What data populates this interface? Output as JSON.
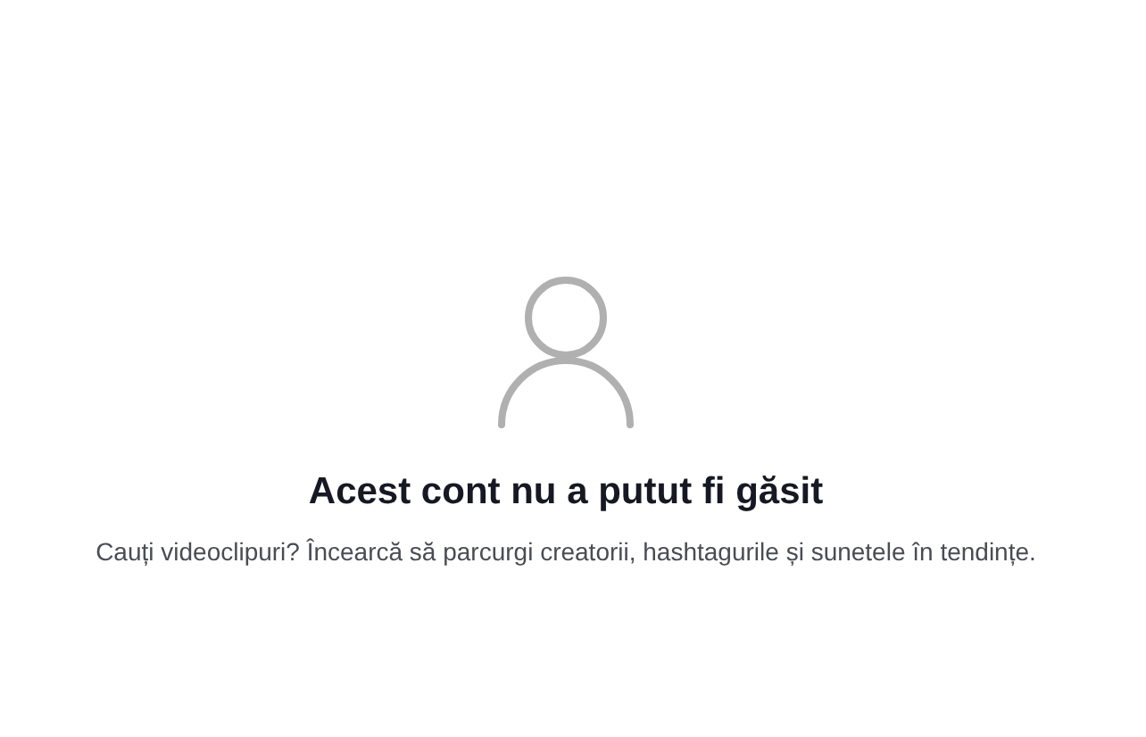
{
  "empty_state": {
    "title": "Acest cont nu a putut fi găsit",
    "description": "Cauți videoclipuri? Încearcă să parcurgi creatorii, hashtagurile și sunetele în tendințe."
  }
}
